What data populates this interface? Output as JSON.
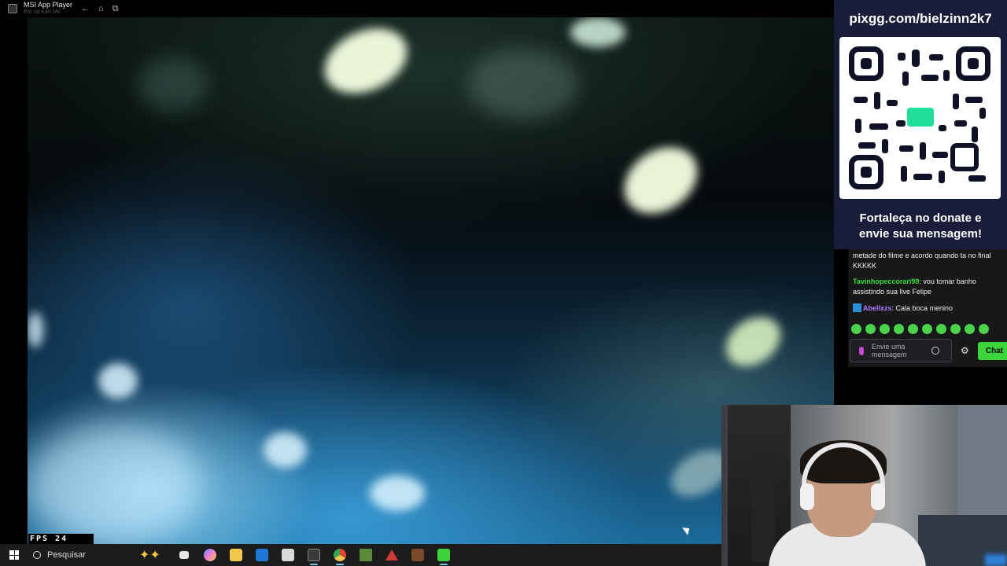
{
  "window": {
    "title": "MSI App Player",
    "subtitle": "Em nd Kart Mil",
    "nav": {
      "back": "←",
      "home": "⌂",
      "multi": "⧉"
    }
  },
  "game": {
    "fps_label": "FPS 24"
  },
  "taskbar": {
    "search_placeholder": "Pesquisar",
    "copilot_glyph": "✦✦",
    "apps": [
      {
        "name": "task-view",
        "color": "#e6e6e6"
      },
      {
        "name": "copilot",
        "color": "#5b8cff"
      },
      {
        "name": "file-explorer",
        "color": "#f2c94c"
      },
      {
        "name": "outlook",
        "color": "#1e78d6"
      },
      {
        "name": "store",
        "color": "#d9d9d9"
      },
      {
        "name": "msi-app-player",
        "color": "#3a3a3a"
      },
      {
        "name": "chrome",
        "color": "#e84335"
      },
      {
        "name": "minecraft",
        "color": "#5a8a3a"
      },
      {
        "name": "autodesk",
        "color": "#d23a3a"
      },
      {
        "name": "game-app",
        "color": "#7a4a2a"
      },
      {
        "name": "kick",
        "color": "#3bd43b"
      }
    ]
  },
  "donate": {
    "url": "pixgg.com/bielzinn2k7",
    "message_line1": "Fortaleça no donate e",
    "message_line2": "envie sua mensagem!",
    "accent": "#1fdf9b"
  },
  "chat": {
    "messages": [
      {
        "user": "",
        "text": "metade do filme e acordo quando ta no final KKKKK"
      },
      {
        "user": "Tavinhopeccorari99",
        "text": ": vou tomar banho assistindo sua live Felipe"
      },
      {
        "user": "Abellxzs",
        "text": ": Cala boca menino"
      }
    ],
    "input_placeholder": "Envie uma mensagem",
    "send_label": "Chat",
    "settings_glyph": "⚙",
    "accent": "#3bd43b"
  }
}
